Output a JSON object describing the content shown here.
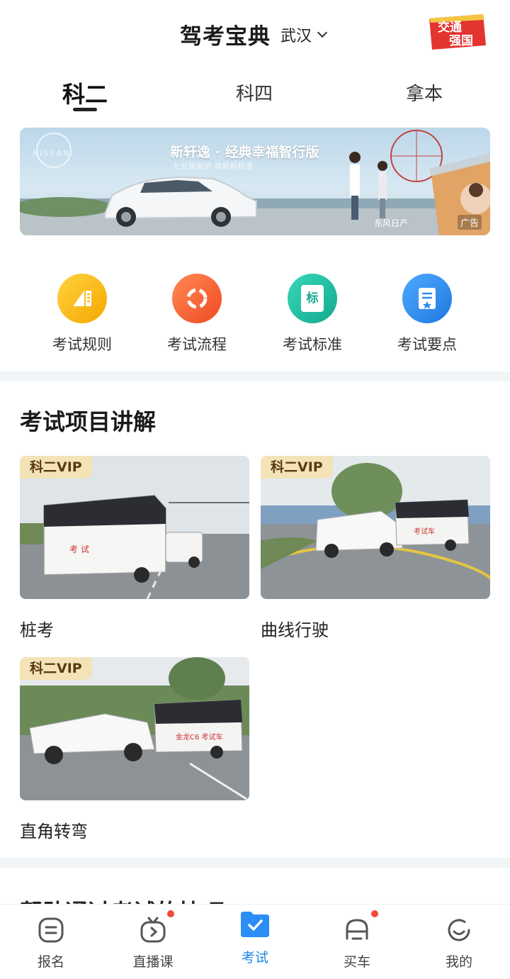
{
  "header": {
    "title": "驾考宝典",
    "city": "武汉",
    "badge_text_line1": "交通",
    "badge_text_line2": "强国"
  },
  "tabs": [
    {
      "label": "科二",
      "active": true
    },
    {
      "label": "科四",
      "active": false
    },
    {
      "label": "拿本",
      "active": false
    }
  ],
  "banner": {
    "brand": "NISSAN",
    "headline": "新轩逸 · 经典幸福智行版",
    "sub": "七五驱新护 焕新新标准",
    "dealer": "东风日产",
    "ad_label": "广告"
  },
  "quick_links": [
    {
      "label": "考试规则",
      "icon": "ruler-icon",
      "color": "#f5b400"
    },
    {
      "label": "考试流程",
      "icon": "flow-icon",
      "color": "#f4602f"
    },
    {
      "label": "考试标准",
      "icon": "standard-doc-icon",
      "color": "#22c2a6",
      "glyph": "标"
    },
    {
      "label": "考试要点",
      "icon": "key-points-icon",
      "color": "#2f8df0"
    }
  ],
  "section": {
    "title": "考试项目讲解",
    "cards": [
      {
        "tag": "科二VIP",
        "label": "桩考",
        "trailer_text": "考 试"
      },
      {
        "tag": "科二VIP",
        "label": "曲线行驶",
        "trailer_text": "考试车"
      },
      {
        "tag": "科二VIP",
        "label": "直角转弯",
        "trailer_text": "金龙C6 考试车"
      }
    ]
  },
  "next_section_peek": "帮助通过考试的技巧",
  "bottom_nav": [
    {
      "label": "报名",
      "icon": "signup-icon",
      "dot": false,
      "active": false
    },
    {
      "label": "直播课",
      "icon": "live-tv-icon",
      "dot": true,
      "active": false
    },
    {
      "label": "考试",
      "icon": "exam-folder-icon",
      "dot": false,
      "active": true
    },
    {
      "label": "买车",
      "icon": "car-icon",
      "dot": true,
      "active": false
    },
    {
      "label": "我的",
      "icon": "profile-icon",
      "dot": false,
      "active": false
    }
  ],
  "colors": {
    "accent": "#1e88e5",
    "vip_bg": "#f3e3b6",
    "dot": "#f04a3a",
    "divider": "#f2f5f7"
  }
}
